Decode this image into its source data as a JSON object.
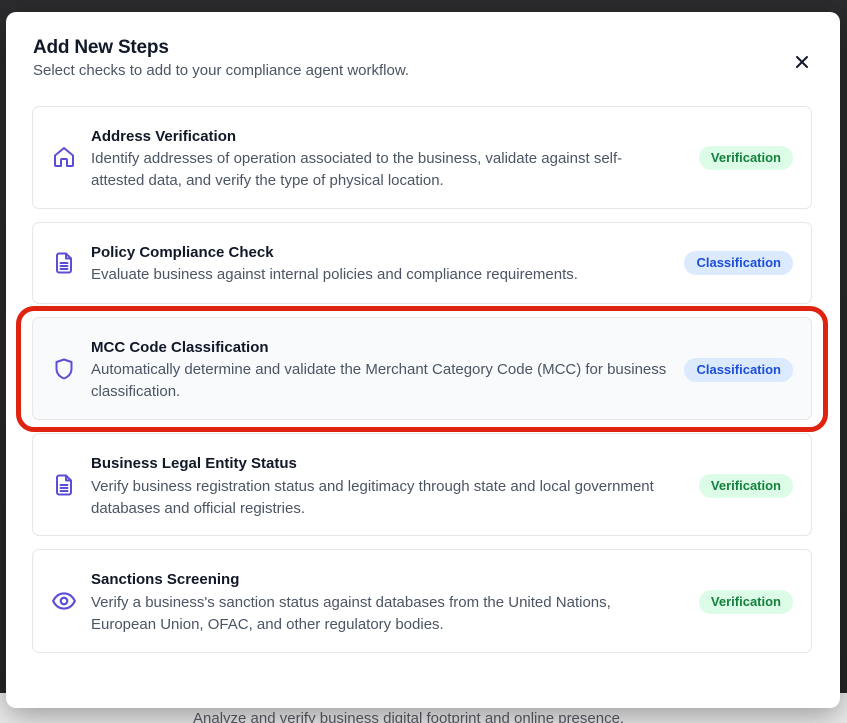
{
  "modal": {
    "title": "Add New Steps",
    "subtitle": "Select checks to add to your compliance agent workflow.",
    "close_icon": "close-icon"
  },
  "steps": [
    {
      "title": "Address Verification",
      "description": "Identify addresses of operation associated to the business, validate against self-attested data, and verify the type of physical location.",
      "badge": "Verification",
      "icon": "home-icon"
    },
    {
      "title": "Policy Compliance Check",
      "description": "Evaluate business against internal policies and compliance requirements.",
      "badge": "Classification",
      "icon": "document-icon"
    },
    {
      "title": "MCC Code Classification",
      "description": "Automatically determine and validate the Merchant Category Code (MCC) for business classification.",
      "badge": "Classification",
      "icon": "shield-icon",
      "highlighted": true
    },
    {
      "title": "Business Legal Entity Status",
      "description": "Verify business registration status and legitimacy through state and local government databases and official registries.",
      "badge": "Verification",
      "icon": "document-icon"
    },
    {
      "title": "Sanctions Screening",
      "description": "Verify a business's sanction status against databases from the United Nations, European Union, OFAC, and other regulatory bodies.",
      "badge": "Verification",
      "icon": "eye-icon"
    }
  ],
  "background": {
    "partial_text": "Analyze and verify business digital footprint and online presence."
  },
  "colors": {
    "icon_accent": "#5b4fd6",
    "highlight": "#e02210",
    "verification_bg": "#dcfce7",
    "verification_text": "#15803d",
    "classification_bg": "#dbeafe",
    "classification_text": "#1d4ed8"
  }
}
